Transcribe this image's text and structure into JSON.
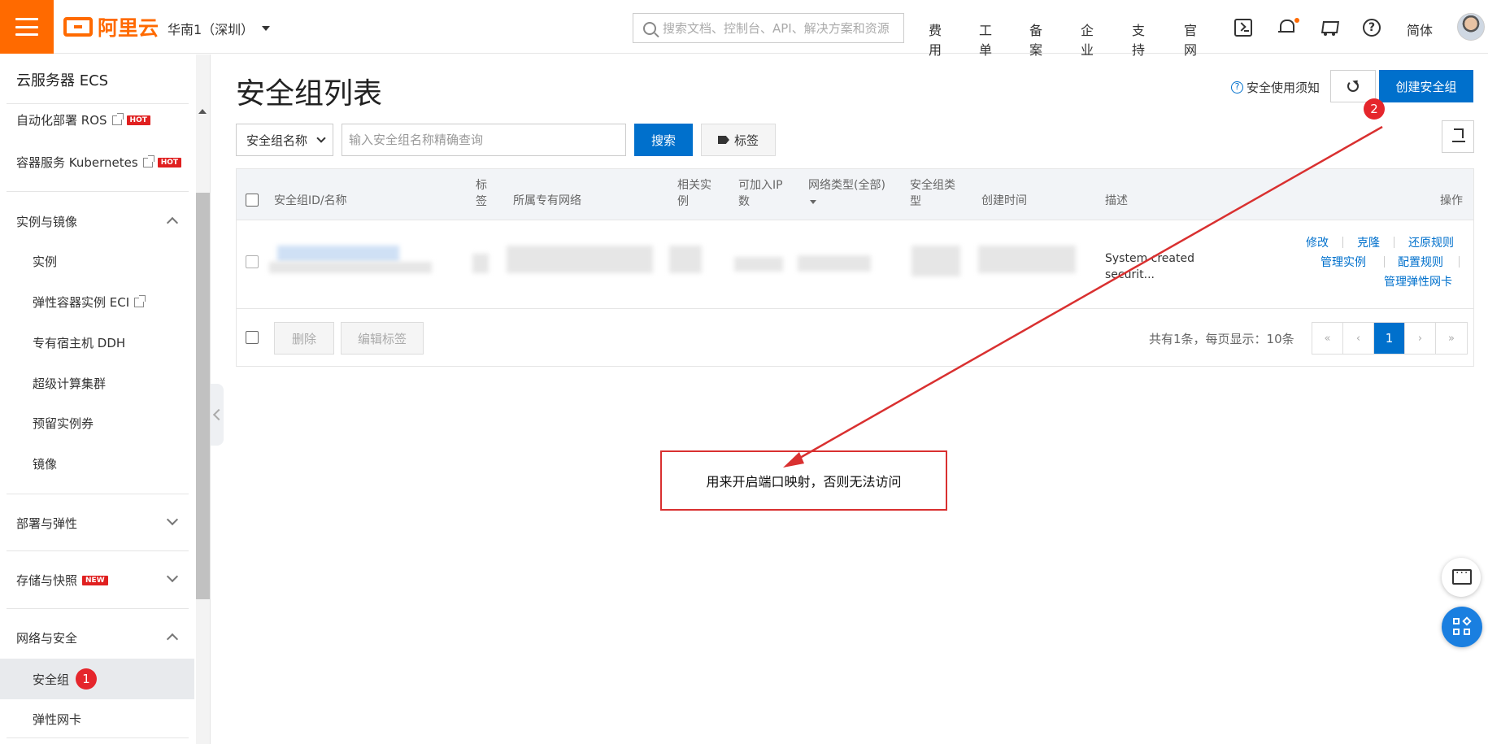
{
  "topbar": {
    "logo_text": "阿里云",
    "region": "华南1（深圳）",
    "search_placeholder": "搜索文档、控制台、API、解决方案和资源",
    "nav": [
      "费用",
      "工单",
      "备案",
      "企业",
      "支持",
      "官网"
    ],
    "language": "简体",
    "icons": [
      "menu-icon",
      "terminal-icon",
      "bell-icon",
      "cart-icon",
      "help-icon"
    ]
  },
  "sidebar": {
    "title": "云服务器 ECS",
    "top_items": [
      {
        "label": "自动化部署 ROS",
        "badge": "HOT"
      },
      {
        "label": "容器服务 Kubernetes",
        "badge": "HOT"
      }
    ],
    "groups": {
      "instance_image": {
        "label": "实例与镜像",
        "items": [
          "实例",
          "弹性容器实例 ECI",
          "专有宿主机 DDH",
          "超级计算集群",
          "预留实例券",
          "镜像"
        ]
      },
      "deploy_elastic": {
        "label": "部署与弹性"
      },
      "storage": {
        "label": "存储与快照",
        "badge": "NEW"
      },
      "network_security": {
        "label": "网络与安全",
        "items": [
          "安全组",
          "弹性网卡"
        ]
      }
    },
    "step_marker": "1"
  },
  "main": {
    "title": "安全组列表",
    "notice": "安全使用须知",
    "create_button": "创建安全组",
    "step_marker": "2",
    "filter": {
      "select_value": "安全组名称",
      "input_placeholder": "输入安全组名称精确查询",
      "search_button": "搜索",
      "tag_button": "标签"
    },
    "table": {
      "columns": {
        "id_name": "安全组ID/名称",
        "tag_l1": "标",
        "tag_l2": "签",
        "vpc": "所属专有网络",
        "related_l1": "相关实",
        "related_l2": "例",
        "ip_l1": "可加入IP",
        "ip_l2": "数",
        "network_type": "网络类型(全部)",
        "sg_type_l1": "安全组类",
        "sg_type_l2": "型",
        "created": "创建时间",
        "description": "描述",
        "actions": "操作"
      },
      "row": {
        "description_l1": "System created",
        "description_l2": "securit...",
        "actions": [
          "修改",
          "克隆",
          "还原规则",
          "管理实例",
          "配置规则",
          "管理弹性网卡"
        ]
      },
      "footer": {
        "delete_button": "删除",
        "edit_tags_button": "编辑标签",
        "summary": "共有1条，每页显示：10条",
        "pages": [
          "«",
          "‹",
          "1",
          "›",
          "»"
        ],
        "current_page": "1"
      }
    }
  },
  "annotation": {
    "text": "用来开启端口映射，否则无法访问",
    "color": "#d93030"
  },
  "colors": {
    "brand": "#ff6a00",
    "primary": "#0070cc",
    "marker": "#e5262c"
  }
}
